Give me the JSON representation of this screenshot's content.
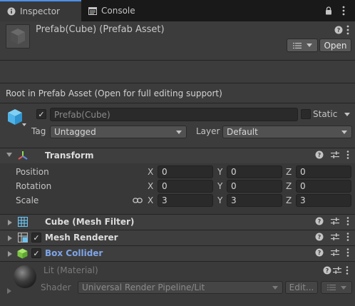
{
  "tabs": [
    {
      "label": "Inspector"
    },
    {
      "label": "Console"
    }
  ],
  "header": {
    "title": "Prefab(Cube) (Prefab Asset)",
    "open_label": "Open"
  },
  "notice": "Root in Prefab Asset (Open for full editing support)",
  "gameobject": {
    "name": "Prefab(Cube)",
    "static_label": "Static",
    "tag_label": "Tag",
    "tag_value": "Untagged",
    "layer_label": "Layer",
    "layer_value": "Default"
  },
  "transform": {
    "title": "Transform",
    "position_label": "Position",
    "rotation_label": "Rotation",
    "scale_label": "Scale",
    "axis_x": "X",
    "axis_y": "Y",
    "axis_z": "Z",
    "position": {
      "x": "0",
      "y": "0",
      "z": "0"
    },
    "rotation": {
      "x": "0",
      "y": "0",
      "z": "0"
    },
    "scale": {
      "x": "3",
      "y": "3",
      "z": "3"
    }
  },
  "components": {
    "mesh_filter": "Cube (Mesh Filter)",
    "mesh_renderer": "Mesh Renderer",
    "box_collider": "Box Collider"
  },
  "material": {
    "name": "Lit (Material)",
    "shader_label": "Shader",
    "shader_value": "Universal Render Pipeline/Lit",
    "edit_label": "Edit..."
  },
  "colors": {
    "accent": "#4d8fea",
    "box_collider_title": "#7ea5e9"
  }
}
